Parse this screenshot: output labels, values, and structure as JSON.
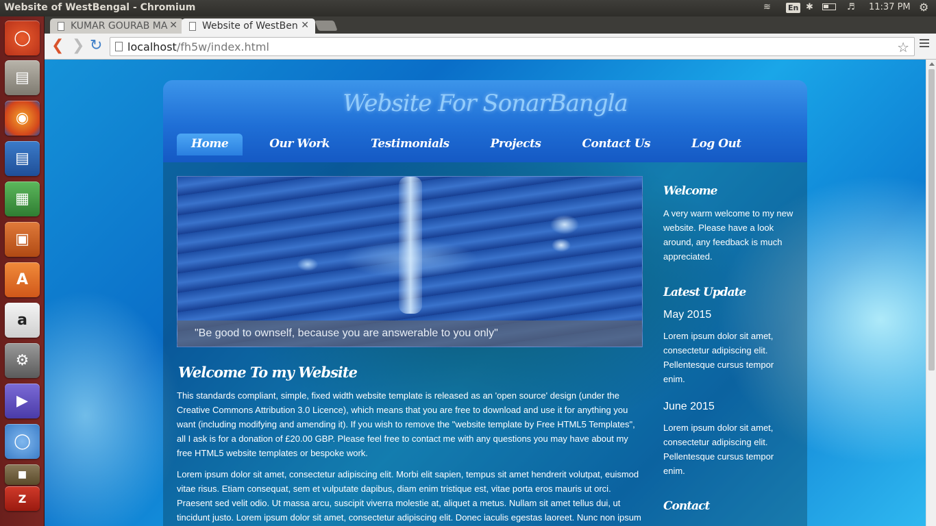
{
  "window": {
    "title": "Website of WestBengal - Chromium"
  },
  "system": {
    "language": "En",
    "time": "11:37 PM"
  },
  "tabs": [
    {
      "label": "KUMAR GOURAB MA"
    },
    {
      "label": "Website of WestBen"
    }
  ],
  "address": {
    "host": "localhost",
    "path": "/fh5w/index.html"
  },
  "site": {
    "title": "Website For SonarBangla",
    "nav": [
      "Home",
      "Our Work",
      "Testimonials",
      "Projects",
      "Contact Us",
      "Log Out"
    ],
    "slide_caption": "\"Be good to ownself, because you are answerable to you only\"",
    "main_heading": "Welcome To my Website",
    "paragraph1": "This standards compliant, simple, fixed width website template is released as an 'open source' design (under the Creative Commons Attribution 3.0 Licence), which means that you are free to download and use it for anything you want (including modifying and amending it). If you wish to remove the \"website template by Free HTML5 Templates\", all I ask is for a donation of £20.00 GBP. Please feel free to contact me with any questions you may have about my free HTML5 website templates or bespoke work.",
    "paragraph2": "Lorem ipsum dolor sit amet, consectetur adipiscing elit. Morbi elit sapien, tempus sit amet hendrerit volutpat, euismod vitae risus. Etiam consequat, sem et vulputate dapibus, diam enim tristique est, vitae porta eros mauris ut orci. Praesent sed velit odio. Ut massa arcu, suscipit viverra molestie at, aliquet a metus. Nullam sit amet tellus dui, ut tincidunt justo. Lorem ipsum dolor sit amet, consectetur adipiscing elit. Donec iaculis egestas laoreet. Nunc non ipsum metus, non",
    "sidebar": {
      "welcome_heading": "Welcome",
      "welcome_text": "A very warm welcome to my new website. Please have a look around, any feedback is much appreciated.",
      "update_heading": "Latest Update",
      "update1_date": "May 2015",
      "update1_text": "Lorem ipsum dolor sit amet, consectetur adipiscing elit. Pellentesque cursus tempor enim.",
      "update2_date": "June 2015",
      "update2_text": "Lorem ipsum dolor sit amet, consectetur adipiscing elit. Pellentesque cursus tempor enim.",
      "contact_heading": "Contact"
    }
  },
  "launcher": {
    "items": [
      "ubuntu-dash-icon",
      "files-icon",
      "firefox-icon",
      "writer-icon",
      "calc-icon",
      "impress-icon",
      "software-center-icon",
      "amazon-icon",
      "system-settings-icon",
      "media-player-icon",
      "chromium-icon",
      "gimp-icon",
      "filezilla-icon"
    ]
  }
}
